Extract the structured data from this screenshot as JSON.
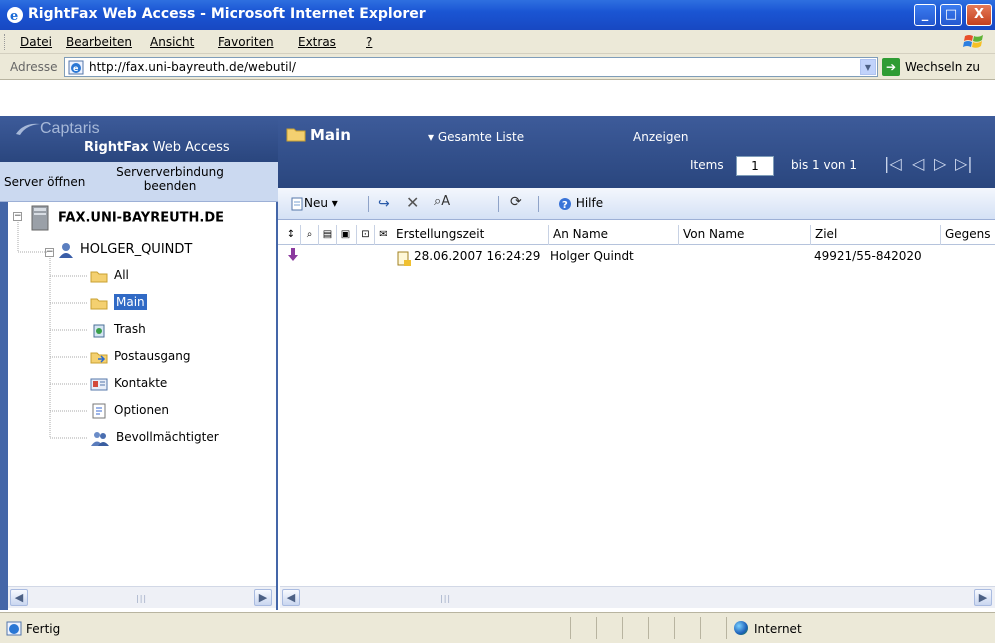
{
  "window": {
    "title": "RightFax Web Access - Microsoft Internet Explorer",
    "min": "_",
    "max": "□",
    "close": "X"
  },
  "menu": [
    "Datei",
    "Bearbeiten",
    "Ansicht",
    "Favoriten",
    "Extras",
    "?"
  ],
  "address": {
    "label": "Adresse",
    "url": "http://fax.uni-bayreuth.de/webutil/",
    "go_label": "Wechseln zu"
  },
  "logo": {
    "brand": "Captaris",
    "product_bold": "RightFax",
    "product_rest": " Web Access"
  },
  "left_actions": {
    "open": "Server öffnen",
    "end": "Serververbindung beenden"
  },
  "tree": {
    "server": "FAX.UNI-BAYREUTH.DE",
    "user": "HOLGER_QUINDT",
    "folders": [
      "All",
      "Main",
      "Trash",
      "Postausgang",
      "Kontakte",
      "Optionen",
      "Bevollmächtigter"
    ],
    "selected": "Main"
  },
  "header": {
    "title": "Main",
    "list_filter": "Gesamte Liste",
    "show": "Anzeigen",
    "items_label": "Items",
    "items_value": "1",
    "range": "bis 1 von 1"
  },
  "toolbar": {
    "new": "Neu",
    "help": "Hilfe"
  },
  "grid": {
    "columns": [
      "Erstellungszeit",
      "An Name",
      "Von Name",
      "Ziel",
      "Gegens"
    ],
    "rows": [
      {
        "created": "28.06.2007 16:24:29",
        "to": "Holger Quindt",
        "from": "",
        "target": "49921/55-842020",
        "subject": ""
      }
    ]
  },
  "status": {
    "text": "Fertig",
    "zone": "Internet"
  },
  "colors": {
    "title_blue": "#1a55d3",
    "panel_blue": "#2a467e",
    "selection": "#316ac5",
    "arrow_purple": "#8b3a9e"
  }
}
